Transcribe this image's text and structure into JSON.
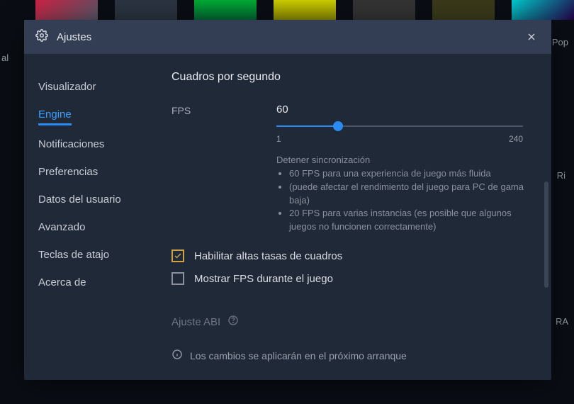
{
  "bg": {
    "popularLabel": "Pop",
    "riLabel": "Ri",
    "raLabel": "RA"
  },
  "modal": {
    "title": "Ajustes"
  },
  "sidebar": {
    "items": [
      {
        "label": "Visualizador",
        "active": false
      },
      {
        "label": "Engine",
        "active": true
      },
      {
        "label": "Notificaciones",
        "active": false
      },
      {
        "label": "Preferencias",
        "active": false
      },
      {
        "label": "Datos del usuario",
        "active": false
      },
      {
        "label": "Avanzado",
        "active": false
      },
      {
        "label": "Teclas de atajo",
        "active": false
      },
      {
        "label": "Acerca de",
        "active": false
      }
    ]
  },
  "content": {
    "section_title": "Cuadros por segundo",
    "fps": {
      "label": "FPS",
      "value": "60",
      "min": "1",
      "max": "240",
      "percent": 25
    },
    "hints": {
      "heading": "Detener sincronización",
      "items": [
        "60 FPS para una experiencia de juego más fluida",
        "(puede afectar el rendimiento del juego para PC de gama baja)",
        "20 FPS para varias instancias (es posible que algunos juegos no funcionen correctamente)"
      ]
    },
    "checkbox_high_fps": {
      "label": "Habilitar altas tasas de cuadros",
      "checked": true
    },
    "checkbox_show_fps": {
      "label": "Mostrar FPS durante el juego",
      "checked": false
    },
    "abi": {
      "label": "Ajuste ABI"
    },
    "notice": "Los cambios se aplicarán en el próximo arranque"
  }
}
